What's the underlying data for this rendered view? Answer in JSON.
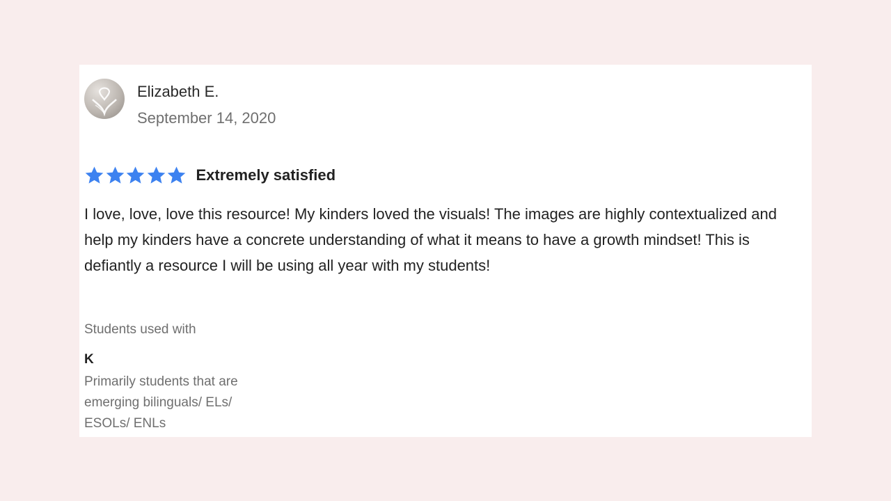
{
  "review": {
    "reviewer_name": "Elizabeth E.",
    "date": "September 14, 2020",
    "avatar_icon": "avatar-logo-icon",
    "rating": {
      "stars": 5,
      "max_stars": 5,
      "star_icon": "star-icon",
      "star_color": "#3d82f0",
      "label": "Extremely satisfied"
    },
    "body": "I love, love, love this resource! My kinders loved the visuals! The images are highly contextualized and help my kinders have a concrete understanding of what it means to have a growth mindset! This is defiantly a resource I will be using all year with my students!",
    "students_used_with": {
      "heading": "Students used with",
      "grade": "K",
      "description": "Primarily students that are emerging bilinguals/ ELs/ ESOLs/ ENLs"
    }
  },
  "colors": {
    "page_background": "#f9eded",
    "card_background": "#ffffff",
    "primary_text": "#222222",
    "secondary_text": "#6f6f6f"
  }
}
